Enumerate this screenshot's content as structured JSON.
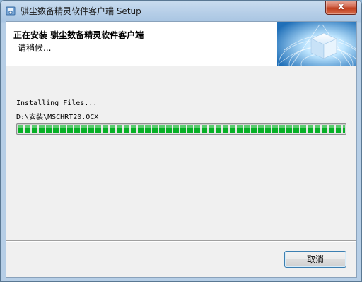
{
  "window": {
    "title": "骐尘数备精灵软件客户端 Setup",
    "close_label": "x"
  },
  "header": {
    "title": "正在安装 骐尘数备精灵软件客户端",
    "subtitle": "请稍候..."
  },
  "main": {
    "status_text": "Installing Files...",
    "current_file": "D:\\安装\\MSCHRT20.OCX",
    "progress_fraction": 1.0
  },
  "buttons": {
    "cancel_label": "取消"
  },
  "colors": {
    "progress": "#06b025",
    "titlebar": "#b7cfe8",
    "close": "#c1401f"
  },
  "icons": {
    "app": "installer-icon",
    "header": "globe-cube-graphic"
  }
}
